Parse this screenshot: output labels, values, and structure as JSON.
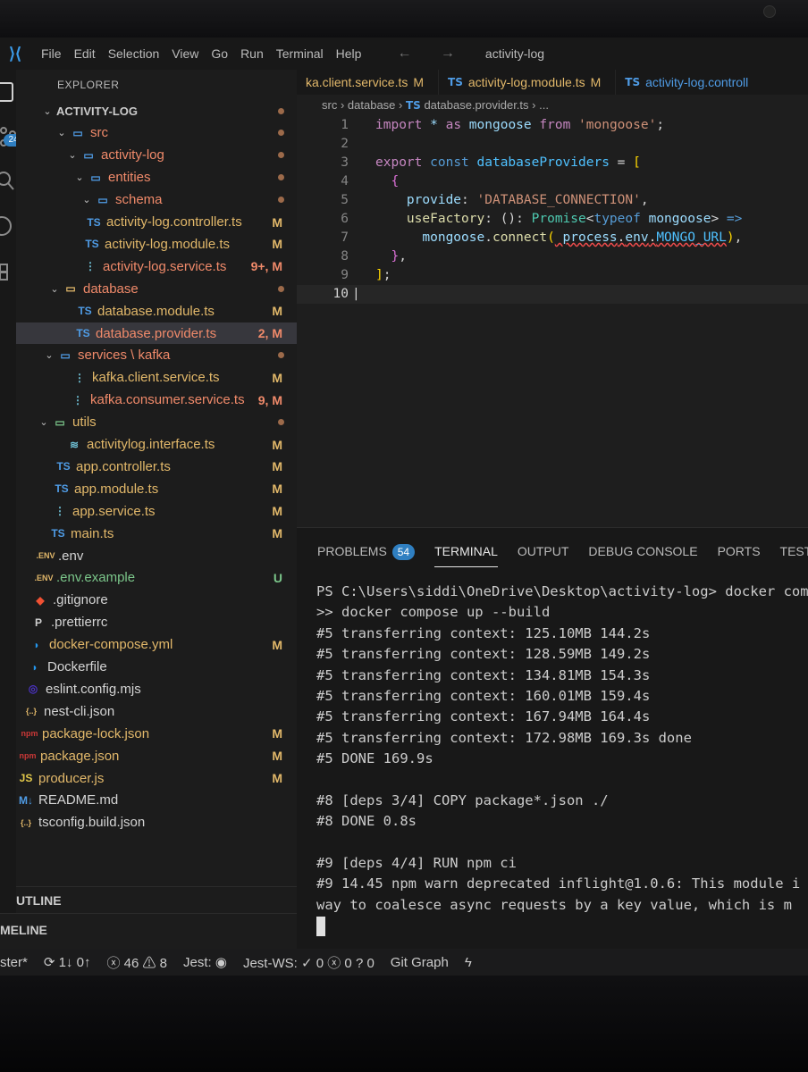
{
  "window": {
    "title": "activity-log",
    "menu": [
      "File",
      "Edit",
      "Selection",
      "View",
      "Go",
      "Run",
      "Terminal",
      "Help"
    ],
    "nav_arrows": "← →"
  },
  "activity_bar": {
    "source_control_badge": "24"
  },
  "sidebar": {
    "header": "EXPLORER",
    "rows": [
      {
        "label": "ACTIVITY-LOG",
        "kind": "root",
        "chev": "⌄",
        "indent": 28,
        "color": "sec",
        "dot": true
      },
      {
        "label": "src",
        "kind": "folder-code",
        "chev": "⌄",
        "indent": 44,
        "color": "err",
        "dot": true
      },
      {
        "label": "activity-log",
        "kind": "folder",
        "chev": "⌄",
        "indent": 56,
        "color": "err",
        "dot": true
      },
      {
        "label": "entities",
        "kind": "folder",
        "chev": "⌄",
        "indent": 64,
        "color": "err",
        "dot": true
      },
      {
        "label": "schema",
        "kind": "folder",
        "chev": "⌄",
        "indent": 72,
        "color": "err",
        "dot": true
      },
      {
        "label": "activity-log.controller.ts",
        "kind": "ts",
        "indent": 76,
        "color": "mod",
        "badge": "M"
      },
      {
        "label": "activity-log.module.ts",
        "kind": "ts",
        "indent": 74,
        "color": "mod",
        "badge": "M"
      },
      {
        "label": "activity-log.service.ts",
        "kind": "svc",
        "indent": 72,
        "color": "err",
        "badge": "9+, M"
      },
      {
        "label": "database",
        "kind": "folder-db",
        "chev": "⌄",
        "indent": 36,
        "color": "err",
        "dot": true
      },
      {
        "label": "database.module.ts",
        "kind": "ts",
        "indent": 66,
        "color": "mod",
        "badge": "M"
      },
      {
        "label": "database.provider.ts",
        "kind": "ts",
        "indent": 64,
        "color": "err",
        "badge": "2, M",
        "selected": true
      },
      {
        "label": "services \\ kafka",
        "kind": "folder",
        "chev": "⌄",
        "indent": 30,
        "color": "err",
        "dot": true
      },
      {
        "label": "kafka.client.service.ts",
        "kind": "svc",
        "indent": 60,
        "color": "mod",
        "badge": "M"
      },
      {
        "label": "kafka.consumer.service.ts",
        "kind": "svc",
        "indent": 58,
        "color": "err",
        "badge": "9, M"
      },
      {
        "label": "utils",
        "kind": "folder-utils",
        "chev": "⌄",
        "indent": 24,
        "color": "mod",
        "dot": true
      },
      {
        "label": "activitylog.interface.ts",
        "kind": "iface",
        "indent": 54,
        "color": "mod",
        "badge": "M"
      },
      {
        "label": "app.controller.ts",
        "kind": "ts",
        "indent": 42,
        "color": "mod",
        "badge": "M"
      },
      {
        "label": "app.module.ts",
        "kind": "ts",
        "indent": 40,
        "color": "mod",
        "badge": "M"
      },
      {
        "label": "app.service.ts",
        "kind": "svc",
        "indent": 38,
        "color": "mod",
        "badge": "M"
      },
      {
        "label": "main.ts",
        "kind": "ts",
        "indent": 36,
        "color": "mod",
        "badge": "M"
      },
      {
        "label": ".env",
        "kind": "env",
        "indent": 22,
        "color": "def"
      },
      {
        "label": ".env.example",
        "kind": "env",
        "indent": 20,
        "color": "new",
        "badge": "U"
      },
      {
        "label": ".gitignore",
        "kind": "git",
        "indent": 16,
        "color": "def"
      },
      {
        "label": ".prettierrc",
        "kind": "prettier",
        "indent": 14,
        "color": "def"
      },
      {
        "label": "docker-compose.yml",
        "kind": "docker",
        "indent": 12,
        "color": "mod",
        "badge": "M"
      },
      {
        "label": "Dockerfile",
        "kind": "docker",
        "indent": 10,
        "color": "def"
      },
      {
        "label": "eslint.config.mjs",
        "kind": "eslint",
        "indent": 8,
        "color": "def"
      },
      {
        "label": "nest-cli.json",
        "kind": "json",
        "indent": 6,
        "color": "def"
      },
      {
        "label": "package-lock.json",
        "kind": "npm",
        "indent": 4,
        "color": "mod",
        "badge": "M"
      },
      {
        "label": "package.json",
        "kind": "npm",
        "indent": 2,
        "color": "mod",
        "badge": "M"
      },
      {
        "label": "producer.js",
        "kind": "js",
        "indent": 0,
        "color": "mod",
        "badge": "M"
      },
      {
        "label": "README.md",
        "kind": "md",
        "indent": 0,
        "color": "def"
      },
      {
        "label": "tsconfig.build.json",
        "kind": "json",
        "indent": 0,
        "color": "def"
      }
    ],
    "outline_label": "UTLINE",
    "timeline_label": "MELINE"
  },
  "editor": {
    "tabs": [
      {
        "label": "ka.client.service.ts",
        "mark": "M",
        "icon": ""
      },
      {
        "label": "activity-log.module.ts",
        "mark": "M",
        "icon": "TS"
      },
      {
        "label": "activity-log.controll",
        "mark": "",
        "icon": "TS"
      }
    ],
    "breadcrumb": [
      "src",
      "database",
      "database.provider.ts",
      "..."
    ],
    "line_numbers": [
      "1",
      "2",
      "3",
      "4",
      "5",
      "6",
      "7",
      "8",
      "9",
      "10"
    ]
  },
  "panel": {
    "tabs": [
      "PROBLEMS",
      "TERMINAL",
      "OUTPUT",
      "DEBUG CONSOLE",
      "PORTS",
      "TEST"
    ],
    "problems_count": "54",
    "terminal_lines": [
      "PS C:\\Users\\siddi\\OneDrive\\Desktop\\activity-log> docker comp",
      ">> docker compose up --build",
      "#5 transferring context: 125.10MB 144.2s",
      "#5 transferring context: 128.59MB 149.2s",
      "#5 transferring context: 134.81MB 154.3s",
      "#5 transferring context: 160.01MB 159.4s",
      "#5 transferring context: 167.94MB 164.4s",
      "#5 transferring context: 172.98MB 169.3s done",
      "#5 DONE 169.9s",
      "",
      "#8 [deps 3/4] COPY package*.json ./",
      "#8 DONE 0.8s",
      "",
      "#9 [deps 4/4] RUN npm ci",
      "#9 14.45 npm warn deprecated inflight@1.0.6: This module i",
      "way to coalesce async requests by a key value, which is m"
    ]
  },
  "status_bar": {
    "branch": "ster*",
    "sync": "1↓ 0↑",
    "errors": "46",
    "warnings": "8",
    "jest": "Jest:",
    "jest_ws": "Jest-WS:",
    "jest_ws_pass": "0",
    "jest_ws_fail": "0",
    "jest_ws_unknown": "0",
    "git_graph": "Git Graph"
  },
  "colors": {
    "modified": "#e2b86a",
    "error": "#f08a6a",
    "untracked": "#7bc68a",
    "ts_blue": "#4f9ce6",
    "accent_badge": "#2f7fc1"
  }
}
